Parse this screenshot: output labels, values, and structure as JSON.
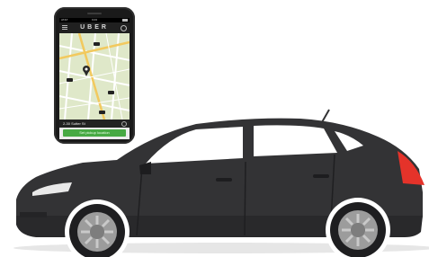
{
  "phone": {
    "status": {
      "carrier": "AT&T",
      "time": "9:03"
    },
    "appbar": {
      "logo": "UBER"
    },
    "pickup": {
      "address": "2-30 Sutter St",
      "button_label": "Set pickup location"
    },
    "icons": {
      "menu": "menu-icon",
      "settings": "gear-icon",
      "clear": "close-icon",
      "pin": "location-pin-icon",
      "car": "car-icon"
    }
  },
  "colors": {
    "car_body": "#333335",
    "taillight": "#e5332a",
    "button_green": "#47a943",
    "map_bg": "#dfe8c9"
  }
}
